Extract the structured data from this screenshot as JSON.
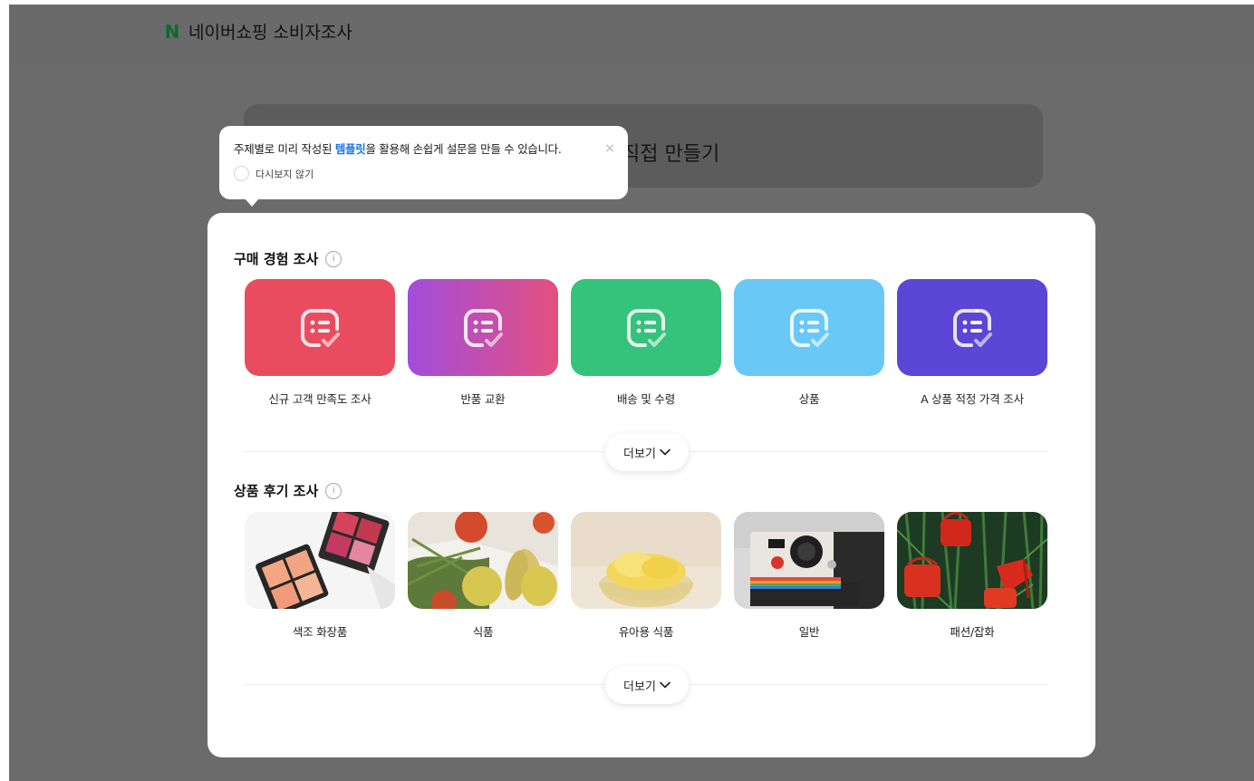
{
  "header": {
    "logo_letter": "N",
    "title": "네이버쇼핑 소비자조사"
  },
  "background_card": {
    "text": "직접 만들기"
  },
  "tooltip": {
    "message_pre": "주제별로 미리 작성된 ",
    "message_highlight": "템플릿",
    "message_post": "을 활용해 손쉽게 설문을 만들 수 있습니다.",
    "close_icon": "×",
    "dont_show_label": "다시보지 않기"
  },
  "sections": {
    "purchase": {
      "title": "구매 경험 조사",
      "info": "i",
      "items": [
        {
          "label": "신규 고객 만족도 조사",
          "color": "#ea4c5f"
        },
        {
          "label": "반품 교환",
          "color": "#b24ed8"
        },
        {
          "label": "배송 및 수령",
          "color": "#35c27b"
        },
        {
          "label": "상품",
          "color": "#69c8f6"
        },
        {
          "label": "A 상품 적정 가격 조사",
          "color": "#5b46d6"
        }
      ],
      "more_label": "더보기"
    },
    "review": {
      "title": "상품 후기 조사",
      "info": "i",
      "items": [
        {
          "label": "색조 화장품"
        },
        {
          "label": "식품"
        },
        {
          "label": "유아용 식품"
        },
        {
          "label": "일반"
        },
        {
          "label": "패션/잡화"
        }
      ],
      "more_label": "더보기"
    }
  },
  "colors": {
    "accent": "#1a73e8",
    "brand": "#0d6b2d"
  }
}
